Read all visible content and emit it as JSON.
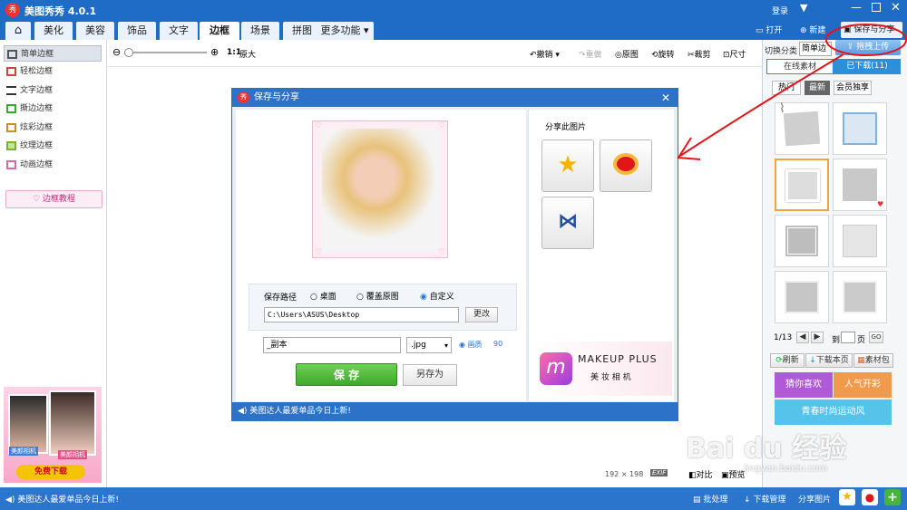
{
  "app": {
    "title": "美图秀秀 4.0.1",
    "login": "登录"
  },
  "tabs": [
    "美化",
    "美容",
    "饰品",
    "文字",
    "边框",
    "场景",
    "拼图",
    "更多功能 ▾"
  ],
  "header_actions": {
    "open": "打开",
    "new": "新建",
    "save_share": "保存与分享"
  },
  "toolbar": {
    "zoom_ratio": "1:1",
    "original_size": "原大",
    "undo": "撤销",
    "redo": "重做",
    "original": "原图",
    "rotate": "旋转",
    "crop": "裁剪",
    "resize": "尺寸"
  },
  "sidebar": {
    "items": [
      "简单边框",
      "轻松边框",
      "文字边框",
      "撕边边框",
      "炫彩边框",
      "纹理边框",
      "动画边框"
    ],
    "tutorial": "边框教程",
    "ad_badge1": "美颜相机",
    "ad_badge2": "美颜相机",
    "ad_btn": "免费下载"
  },
  "dialog": {
    "title": "保存与分享",
    "share_label": "分享此图片",
    "path_label": "保存路径",
    "radio_desktop": "桌面",
    "radio_overwrite": "覆盖原图",
    "radio_custom": "自定义",
    "path_value": "C:\\Users\\ASUS\\Desktop",
    "change_btn": "更改",
    "filename_value": "_副本",
    "format_value": ".jpg",
    "quality_label": "画质",
    "quality_value": "90",
    "save_btn": "保 存",
    "saveas_btn": "另存为",
    "ad_brand": "MAKEUP PLUS",
    "ad_sub": "美 妆 相 机",
    "footer_tip": "美图达人最爱单品今日上新!"
  },
  "right": {
    "switch_category": "切换分类",
    "current_category": "简单边框",
    "drag_upload": "拖拽上传",
    "tab_online": "在线素材",
    "tab_downloaded": "已下载(11)",
    "sub_hot": "热门",
    "sub_new": "最新",
    "sub_member": "会员独享",
    "page_info": "1/13",
    "goto_label": "到",
    "page_label": "页",
    "go_btn": "GO",
    "refresh": "刷新",
    "download_page": "下载本页",
    "material_pack": "素材包",
    "promo1": "猜你喜欢",
    "promo2": "人气开彩",
    "promo3": "青春时尚运动风"
  },
  "canvas": {
    "dims": "192 × 198",
    "exif": "EXIF",
    "compare": "对比",
    "preview": "预览"
  },
  "status": {
    "tip": "美图达人最爱单品今日上新!",
    "batch": "批处理",
    "download_mgr": "下载管理",
    "share_pic": "分享图片"
  },
  "watermark": "Bai du 经验",
  "watermark_url": "jingyan.baidu.com",
  "colors": {
    "primary": "#1f6cc6",
    "save_green": "#4cb53a",
    "accent_red": "#e0161b"
  }
}
